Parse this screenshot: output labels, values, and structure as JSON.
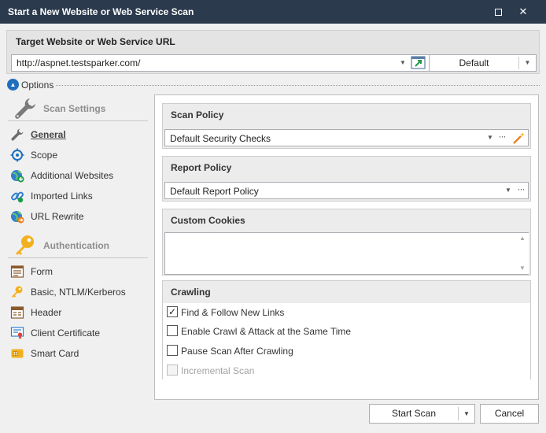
{
  "window": {
    "title": "Start a New Website or Web Service Scan",
    "maximize_label": "☐",
    "close_label": "✕"
  },
  "target": {
    "header": "Target Website or Web Service URL",
    "url_value": "http://aspnet.testsparker.com/",
    "profile_value": "Default"
  },
  "options": {
    "label": "Options"
  },
  "sidebar": {
    "scan_settings": {
      "title": "Scan Settings",
      "icon": "wrench-icon",
      "items": [
        {
          "label": "General",
          "icon": "wrench-icon",
          "selected": true
        },
        {
          "label": "Scope",
          "icon": "target-icon",
          "selected": false
        },
        {
          "label": "Additional Websites",
          "icon": "globe-add-icon",
          "selected": false
        },
        {
          "label": "Imported Links",
          "icon": "link-icon",
          "selected": false
        },
        {
          "label": "URL Rewrite",
          "icon": "globe-rewrite-icon",
          "selected": false
        }
      ]
    },
    "authentication": {
      "title": "Authentication",
      "icon": "key-icon",
      "items": [
        {
          "label": "Form",
          "icon": "form-icon"
        },
        {
          "label": "Basic, NTLM/Kerberos",
          "icon": "key-icon"
        },
        {
          "label": "Header",
          "icon": "header-icon"
        },
        {
          "label": "Client Certificate",
          "icon": "certificate-icon"
        },
        {
          "label": "Smart Card",
          "icon": "smart-card-icon"
        }
      ]
    }
  },
  "scan_policy": {
    "header": "Scan Policy",
    "value": "Default Security Checks"
  },
  "report_policy": {
    "header": "Report Policy",
    "value": "Default Report Policy"
  },
  "custom_cookies": {
    "header": "Custom Cookies",
    "value": ""
  },
  "crawling": {
    "header": "Crawling",
    "options": [
      {
        "label": "Find & Follow New Links",
        "checked": true,
        "enabled": true
      },
      {
        "label": "Enable Crawl & Attack at the Same Time",
        "checked": false,
        "enabled": true
      },
      {
        "label": "Pause Scan After Crawling",
        "checked": false,
        "enabled": true
      },
      {
        "label": "Incremental Scan",
        "checked": false,
        "enabled": false
      }
    ]
  },
  "footer": {
    "start_label": "Start Scan",
    "cancel_label": "Cancel"
  },
  "colors": {
    "title_bar": "#2b3a4d",
    "accent_blue": "#1f6fbd",
    "key_yellow": "#f2b01e",
    "wand_orange": "#e8821e"
  }
}
